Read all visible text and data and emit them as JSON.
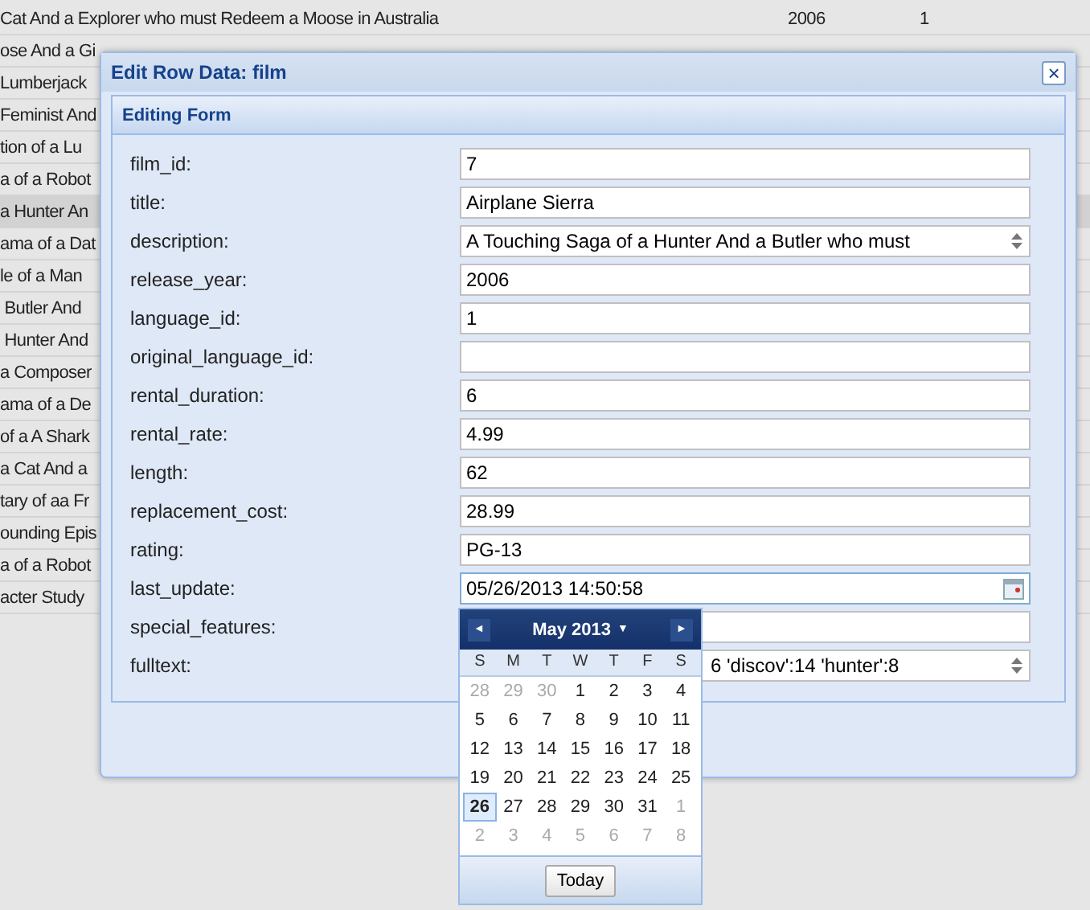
{
  "table": {
    "rows": [
      {
        "text": "Cat And a Explorer who must Redeem a Moose in Australia",
        "year": "2006",
        "count": "1",
        "selected": false
      },
      {
        "text": "ose And a Gi",
        "selected": false
      },
      {
        "text": "Lumberjack",
        "selected": false
      },
      {
        "text": "Feminist And",
        "selected": false
      },
      {
        "text": "tion of a Lu",
        "selected": false
      },
      {
        "text": "a of a Robot",
        "selected": false
      },
      {
        "text": "a Hunter An",
        "selected": true
      },
      {
        "text": "ama of a Dat",
        "selected": false
      },
      {
        "text": "le of a Man",
        "selected": false
      },
      {
        "text": " Butler And",
        "selected": false
      },
      {
        "text": " Hunter And",
        "selected": false
      },
      {
        "text": "a Composer",
        "selected": false
      },
      {
        "text": "ama of a De",
        "selected": false
      },
      {
        "text": "of a A Shark",
        "selected": false
      },
      {
        "text": "a Cat And a",
        "selected": false
      },
      {
        "text": "tary of aa Fr",
        "selected": false
      },
      {
        "text": "ounding Epis",
        "selected": false
      },
      {
        "text": "a of a Robot",
        "selected": false
      },
      {
        "text": "acter Study",
        "selected": false
      }
    ]
  },
  "dialog": {
    "title": "Edit Row Data: film",
    "close": "×",
    "form_title": "Editing Form",
    "fields": [
      {
        "label": "film_id:",
        "value": "7",
        "kind": "text"
      },
      {
        "label": "title:",
        "value": "Airplane Sierra",
        "kind": "text"
      },
      {
        "label": "description:",
        "value": "A Touching Saga of a Hunter And a Butler who must",
        "kind": "textarea"
      },
      {
        "label": "release_year:",
        "value": "2006",
        "kind": "text"
      },
      {
        "label": "language_id:",
        "value": "1",
        "kind": "text"
      },
      {
        "label": "original_language_id:",
        "kind": "text"
      },
      {
        "label": "rental_duration:",
        "value": "6",
        "kind": "text"
      },
      {
        "label": "rental_rate:",
        "value": "4.99",
        "kind": "text"
      },
      {
        "label": "length:",
        "value": "62",
        "kind": "text"
      },
      {
        "label": "replacement_cost:",
        "value": "28.99",
        "kind": "text"
      },
      {
        "label": "rating:",
        "value": "PG-13",
        "kind": "text"
      },
      {
        "label": "last_update:",
        "value": "05/26/2013 14:50:58",
        "kind": "date"
      },
      {
        "label": "special_features:",
        "kind": "covered"
      },
      {
        "label": "fulltext:",
        "value": "6 'discov':14 'hunter':8",
        "kind": "covered-textarea"
      }
    ]
  },
  "calendar": {
    "month": "May 2013",
    "prev": "◄",
    "next": "►",
    "caret": "▼",
    "weekdays": [
      "S",
      "M",
      "T",
      "W",
      "T",
      "F",
      "S"
    ],
    "weeks": [
      [
        {
          "day": "28",
          "muted": true,
          "selected": false
        },
        {
          "day": "29",
          "muted": true,
          "selected": false
        },
        {
          "day": "30",
          "muted": true,
          "selected": false
        },
        {
          "day": "1",
          "muted": false,
          "selected": false
        },
        {
          "day": "2",
          "muted": false,
          "selected": false
        },
        {
          "day": "3",
          "muted": false,
          "selected": false
        },
        {
          "day": "4",
          "muted": false,
          "selected": false
        }
      ],
      [
        {
          "day": "5",
          "muted": false,
          "selected": false
        },
        {
          "day": "6",
          "muted": false,
          "selected": false
        },
        {
          "day": "7",
          "muted": false,
          "selected": false
        },
        {
          "day": "8",
          "muted": false,
          "selected": false
        },
        {
          "day": "9",
          "muted": false,
          "selected": false
        },
        {
          "day": "10",
          "muted": false,
          "selected": false
        },
        {
          "day": "11",
          "muted": false,
          "selected": false
        }
      ],
      [
        {
          "day": "12",
          "muted": false,
          "selected": false
        },
        {
          "day": "13",
          "muted": false,
          "selected": false
        },
        {
          "day": "14",
          "muted": false,
          "selected": false
        },
        {
          "day": "15",
          "muted": false,
          "selected": false
        },
        {
          "day": "16",
          "muted": false,
          "selected": false
        },
        {
          "day": "17",
          "muted": false,
          "selected": false
        },
        {
          "day": "18",
          "muted": false,
          "selected": false
        }
      ],
      [
        {
          "day": "19",
          "muted": false,
          "selected": false
        },
        {
          "day": "20",
          "muted": false,
          "selected": false
        },
        {
          "day": "21",
          "muted": false,
          "selected": false
        },
        {
          "day": "22",
          "muted": false,
          "selected": false
        },
        {
          "day": "23",
          "muted": false,
          "selected": false
        },
        {
          "day": "24",
          "muted": false,
          "selected": false
        },
        {
          "day": "25",
          "muted": false,
          "selected": false
        }
      ],
      [
        {
          "day": "26",
          "muted": false,
          "selected": true
        },
        {
          "day": "27",
          "muted": false,
          "selected": false
        },
        {
          "day": "28",
          "muted": false,
          "selected": false
        },
        {
          "day": "29",
          "muted": false,
          "selected": false
        },
        {
          "day": "30",
          "muted": false,
          "selected": false
        },
        {
          "day": "31",
          "muted": false,
          "selected": false
        },
        {
          "day": "1",
          "muted": true,
          "selected": false
        }
      ],
      [
        {
          "day": "2",
          "muted": true,
          "selected": false
        },
        {
          "day": "3",
          "muted": true,
          "selected": false
        },
        {
          "day": "4",
          "muted": true,
          "selected": false
        },
        {
          "day": "5",
          "muted": true,
          "selected": false
        },
        {
          "day": "6",
          "muted": true,
          "selected": false
        },
        {
          "day": "7",
          "muted": true,
          "selected": false
        },
        {
          "day": "8",
          "muted": true,
          "selected": false
        }
      ]
    ],
    "today": "Today"
  }
}
